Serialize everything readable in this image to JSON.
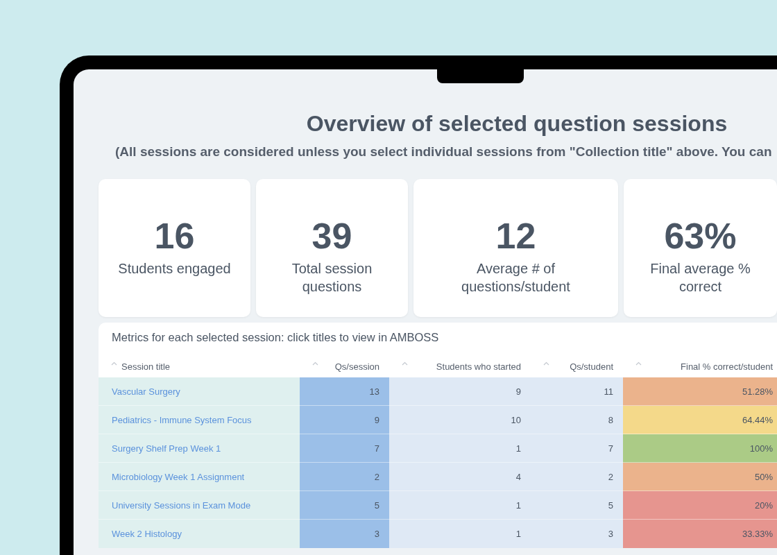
{
  "title": "Overview of selected question sessions",
  "subtitle": "(All sessions are considered unless you select individual sessions from \"Collection title\" above. You can",
  "stats": [
    {
      "value": "16",
      "label": "Students engaged"
    },
    {
      "value": "39",
      "label": "Total session questions"
    },
    {
      "value": "12",
      "label": "Average # of questions/student"
    },
    {
      "value": "63%",
      "label": "Final average % correct"
    }
  ],
  "table": {
    "heading": "Metrics for each selected session: click titles to view in AMBOSS",
    "columns": [
      "Session title",
      "Qs/session",
      "Students who started",
      "Qs/student",
      "Final % correct/student"
    ],
    "rows": [
      {
        "title": "Vascular Surgery",
        "qs_session": "13",
        "students_started": "9",
        "qs_student": "11",
        "final_correct": "51.28%",
        "color": "#ebb38c"
      },
      {
        "title": "Pediatrics - Immune System Focus",
        "qs_session": "9",
        "students_started": "10",
        "qs_student": "8",
        "final_correct": "64.44%",
        "color": "#f4d98a"
      },
      {
        "title": "Surgery Shelf Prep Week 1",
        "qs_session": "7",
        "students_started": "1",
        "qs_student": "7",
        "final_correct": "100%",
        "color": "#abcb86"
      },
      {
        "title": "Microbiology Week 1 Assignment",
        "qs_session": "2",
        "students_started": "4",
        "qs_student": "2",
        "final_correct": "50%",
        "color": "#ebb38c"
      },
      {
        "title": "University Sessions in Exam Mode",
        "qs_session": "5",
        "students_started": "1",
        "qs_student": "5",
        "final_correct": "20%",
        "color": "#e6958f"
      },
      {
        "title": "Week 2 Histology",
        "qs_session": "3",
        "students_started": "1",
        "qs_student": "3",
        "final_correct": "33.33%",
        "color": "#e6958f"
      }
    ]
  }
}
